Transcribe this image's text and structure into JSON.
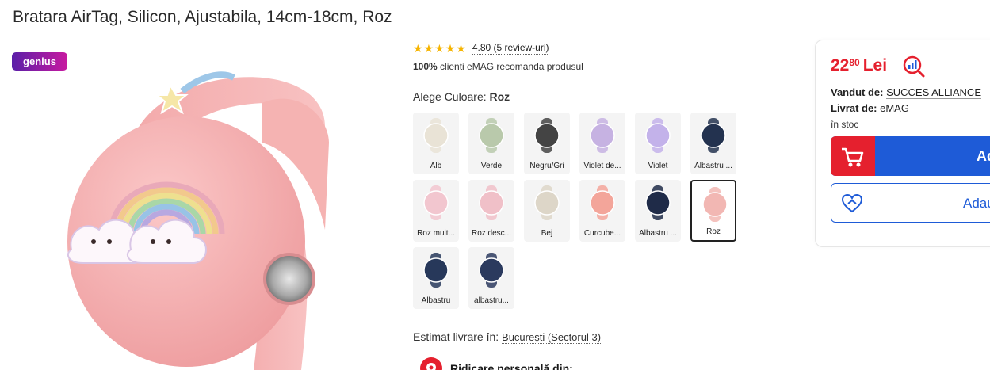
{
  "product": {
    "title": "Bratara AirTag, Silicon, Ajustabila, 14cm-18cm, Roz",
    "badge": "genius"
  },
  "rating": {
    "stars": 5,
    "text": "4.80 (5 review-uri)",
    "recommend_bold": "100%",
    "recommend_text": " clienti eMAG recomanda produsul"
  },
  "color": {
    "label": "Alege Culoare: ",
    "selected": "Roz",
    "options": [
      {
        "label": "Alb",
        "color": "#e9e3d6"
      },
      {
        "label": "Verde",
        "color": "#b9c9ab"
      },
      {
        "label": "Negru/Gri",
        "color": "#444444"
      },
      {
        "label": "Violet de...",
        "color": "#c6b2e2"
      },
      {
        "label": "Violet",
        "color": "#c3b2ea"
      },
      {
        "label": "Albastru ...",
        "color": "#23324f"
      },
      {
        "label": "Roz mult...",
        "color": "#f2c6cf"
      },
      {
        "label": "Roz desc...",
        "color": "#f0c0c8"
      },
      {
        "label": "Bej",
        "color": "#ddd6c8"
      },
      {
        "label": "Curcube...",
        "color": "#f3a59a"
      },
      {
        "label": "Albastru ...",
        "color": "#1f2b48"
      },
      {
        "label": "Roz",
        "color": "#f2b7b3"
      },
      {
        "label": "Albastru",
        "color": "#27385a"
      },
      {
        "label": "albastru...",
        "color": "#2b3a5e"
      }
    ]
  },
  "delivery": {
    "label": "Estimat livrare în: ",
    "location": "București (Sectorul 3)",
    "pickup": "Ridicare personală din:"
  },
  "buybox": {
    "price_int": "22",
    "price_dec": "80",
    "currency": "Lei",
    "sold_by_label": "Vandut de: ",
    "sold_by": "SUCCES ALLIANCE",
    "delivered_by_label": "Livrat de: ",
    "delivered_by": "eMAG",
    "stock": "în stoc",
    "add_to_cart": "Ad",
    "add_to_fav": "Adau"
  },
  "colors": {
    "accent_red": "#e5202e",
    "accent_blue": "#1e5bd7",
    "star": "#f6b400"
  }
}
